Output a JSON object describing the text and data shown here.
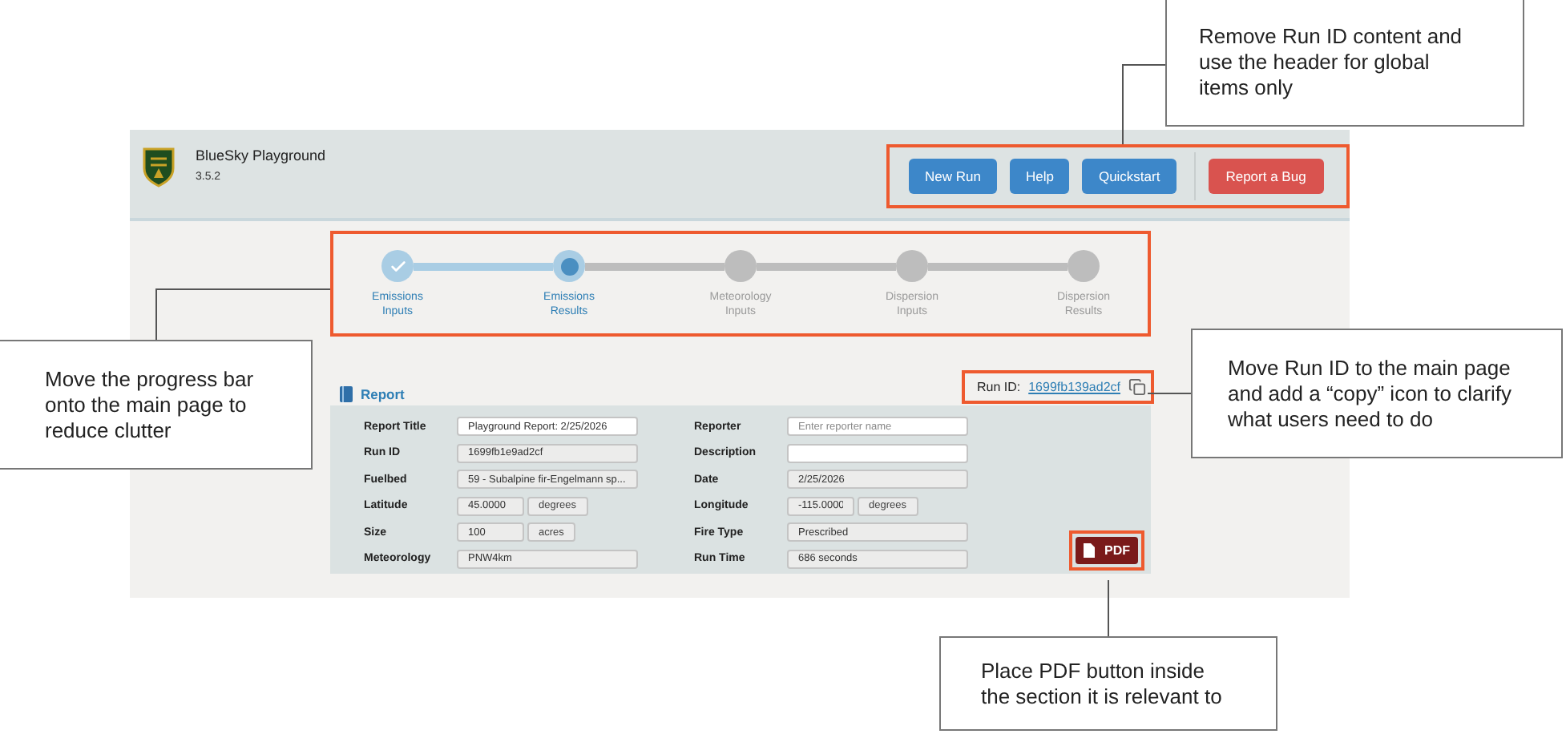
{
  "app": {
    "title": "BlueSky Playground",
    "version": "3.5.2",
    "header_buttons": [
      {
        "label": "New Run",
        "kind": "primary"
      },
      {
        "label": "Help",
        "kind": "primary"
      },
      {
        "label": "Quickstart",
        "kind": "primary"
      },
      {
        "label": "Report a Bug",
        "kind": "danger"
      }
    ],
    "steps": [
      {
        "label": "Emissions Inputs",
        "completed": true,
        "selected": false
      },
      {
        "label": "Emissions Results",
        "completed": false,
        "selected": true
      },
      {
        "label": "Meteorology Inputs",
        "completed": false,
        "selected": false
      },
      {
        "label": "Dispersion Inputs",
        "completed": false,
        "selected": false
      },
      {
        "label": "Dispersion Results",
        "completed": false,
        "selected": false
      }
    ],
    "report": {
      "title": "Report",
      "run_id_label": "Run ID:",
      "run_id": "1699fb139ad2cf",
      "pdf_button": "PDF",
      "fields": [
        {
          "label": "Report Title",
          "value": "Playground Report: 2/25/2026",
          "disabled": false
        },
        {
          "label": "Reporter",
          "placeholder": "Enter reporter name",
          "disabled": false
        },
        {
          "label": "Run ID",
          "value": "1699fb1e9ad2cf",
          "disabled": true
        },
        {
          "label": "Description",
          "disabled": false
        },
        {
          "label": "Fuelbed",
          "value": "59 - Subalpine fir-Engelmann sp...",
          "disabled": true
        },
        {
          "label": "Date",
          "value": "2/25/2026",
          "disabled": true
        },
        {
          "label": "Latitude",
          "value": "45.0000",
          "unit": "degrees",
          "disabled": true
        },
        {
          "label": "Longitude",
          "value": "-115.0000",
          "unit": "degrees",
          "disabled": true
        },
        {
          "label": "Size",
          "value": "100",
          "unit": "acres",
          "disabled": true
        },
        {
          "label": "Fire Type",
          "value": "Prescribed",
          "disabled": true
        },
        {
          "label": "Meteorology",
          "value": "PNW4km",
          "disabled": true
        },
        {
          "label": "Run Time",
          "value": "686 seconds",
          "disabled": true
        }
      ]
    }
  },
  "annotations": [
    {
      "text": "Remove Run ID content and use the header for global items only"
    },
    {
      "text": "Move the progress bar onto the main page to reduce clutter"
    },
    {
      "text": "Move Run ID to the main page and add a “copy” icon to clarify what users need to do"
    },
    {
      "text": "Place PDF button inside the section it is relevant to"
    }
  ]
}
